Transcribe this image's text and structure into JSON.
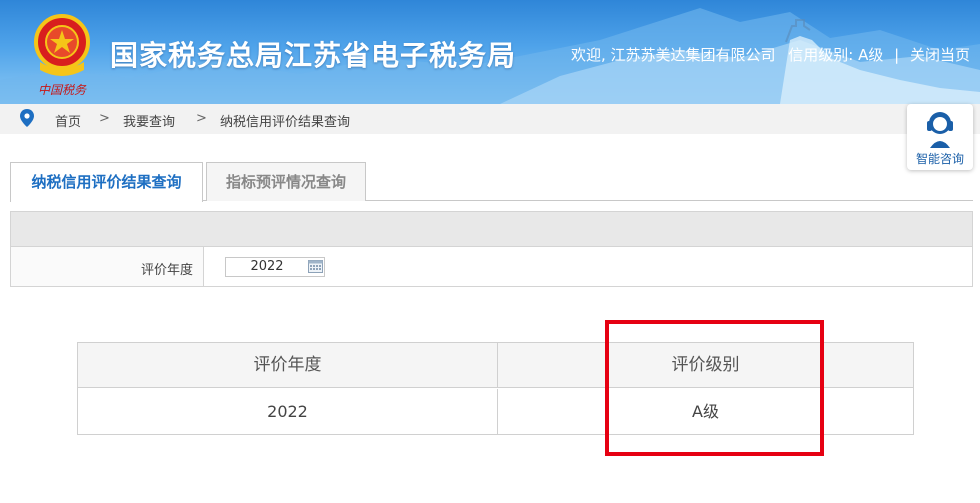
{
  "header": {
    "site_title": "国家税务总局江苏省电子税务局",
    "welcome": "欢迎, 江苏苏美达集团有限公司",
    "credit_level": "信用级别: A级",
    "separator": "|",
    "close_page": "关闭当页",
    "emblem_motto": "中国税务"
  },
  "breadcrumb": {
    "items": [
      "首页",
      "我要查询",
      "纳税信用评价结果查询"
    ],
    "separator": ">"
  },
  "consult": {
    "label": "智能咨询"
  },
  "tabs": [
    {
      "label": "纳税信用评价结果查询",
      "active": true
    },
    {
      "label": "指标预评情况查询",
      "active": false
    }
  ],
  "query_form": {
    "year_label": "评价年度",
    "year_value": "2022"
  },
  "result_table": {
    "headers": [
      "评价年度",
      "评价级别"
    ],
    "rows": [
      [
        "2022",
        "A级"
      ]
    ]
  },
  "colors": {
    "header_blue": "#2f86d8",
    "tab_active_text": "#1e6fc2",
    "highlight_red": "#e60012"
  }
}
